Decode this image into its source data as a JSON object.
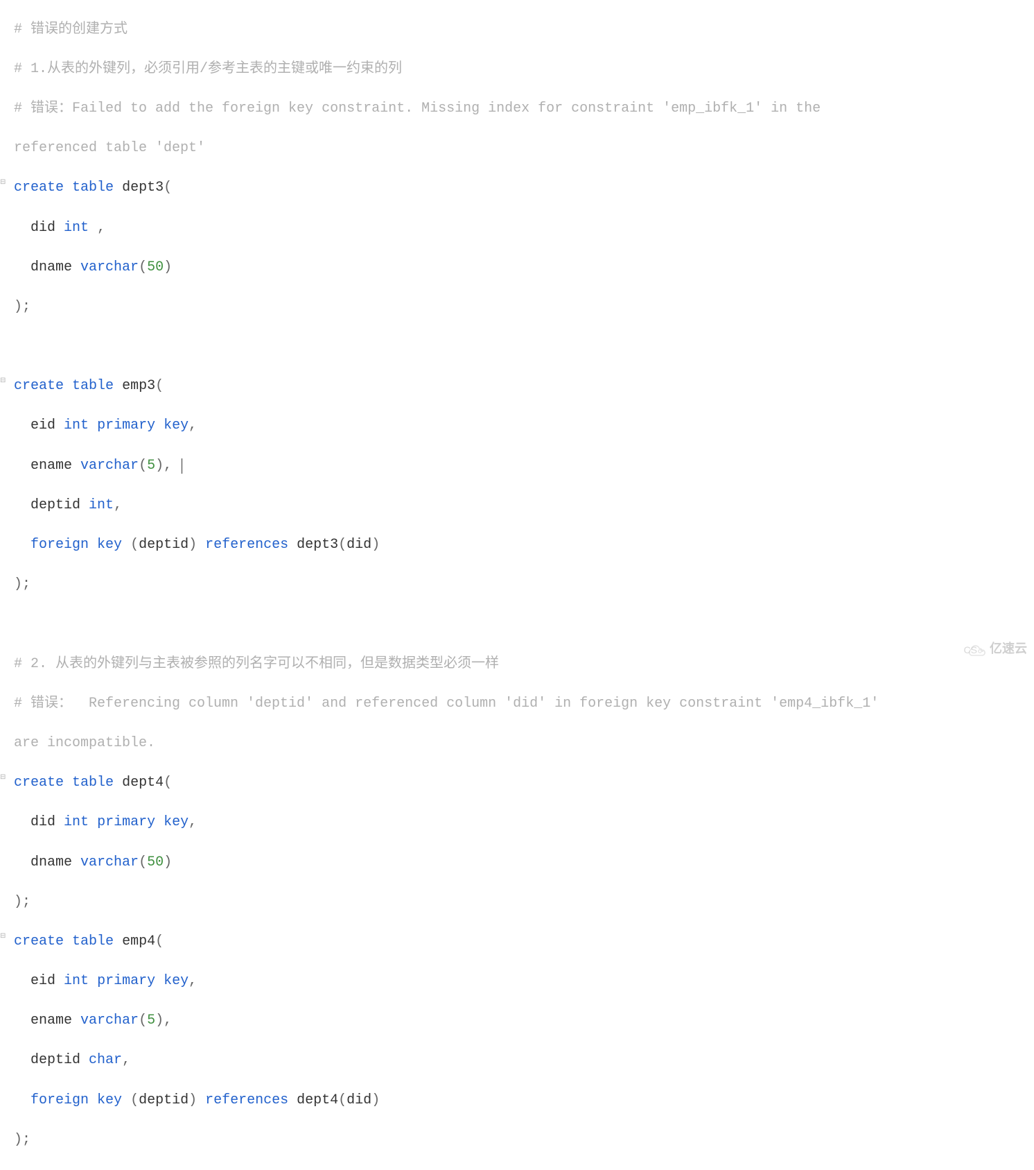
{
  "lines": {
    "l1": {
      "comment": " # 错误的创建方式"
    },
    "l2": {
      "comment": " # 1.从表的外键列，必须引用/参考主表的主键或唯一约束的列"
    },
    "l3": {
      "comment": " # 错误：Failed to add the foreign key constraint. Missing index for constraint 'emp_ibfk_1' in the "
    },
    "l4": {
      "comment": " referenced table 'dept'"
    },
    "l5": {
      "kw1": "create",
      "kw2": "table",
      "name": "dept3",
      "open": "("
    },
    "l6": {
      "indent": "   ",
      "col": "did",
      "type": "int",
      "tail": " ,"
    },
    "l7": {
      "indent": "   ",
      "col": "dname",
      "type": "varchar",
      "open": "(",
      "n": "50",
      "close": ")"
    },
    "l8": {
      "close": " );"
    },
    "l9": {
      "blank": " "
    },
    "l10": {
      "kw1": "create",
      "kw2": "table",
      "name": "emp3",
      "open": "("
    },
    "l11": {
      "indent": "   ",
      "col": "eid",
      "type": "int",
      "kw3": "primary",
      "kw4": "key",
      "tail": ","
    },
    "l12": {
      "indent": "   ",
      "col": "ename",
      "type": "varchar",
      "open": "(",
      "n": "5",
      "close": "),",
      "cursor": true
    },
    "l13": {
      "indent": "   ",
      "col": "deptid",
      "type": "int",
      "tail": ","
    },
    "l14": {
      "indent": "   ",
      "kw1": "foreign",
      "kw2": "key",
      "open1": " (",
      "arg1": "deptid",
      "close1": ") ",
      "kw3": "references",
      "tbl": " dept3",
      "open2": "(",
      "arg2": "did",
      "close2": ")"
    },
    "l15": {
      "close": " );"
    },
    "l16": {
      "blank": " "
    },
    "l17": {
      "comment": " # 2. 从表的外键列与主表被参照的列名字可以不相同，但是数据类型必须一样"
    },
    "l18": {
      "comment": " # 错误：  Referencing column 'deptid' and referenced column 'did' in foreign key constraint 'emp4_ibfk_1' "
    },
    "l19": {
      "comment": " are incompatible."
    },
    "l20": {
      "kw1": "create",
      "kw2": "table",
      "name": "dept4",
      "open": "("
    },
    "l21": {
      "indent": "   ",
      "col": "did",
      "type": "int",
      "kw3": "primary",
      "kw4": "key",
      "tail": ","
    },
    "l22": {
      "indent": "   ",
      "col": "dname",
      "type": "varchar",
      "open": "(",
      "n": "50",
      "close": ")"
    },
    "l23": {
      "close": " );"
    },
    "l24": {
      "kw1": "create",
      "kw2": "table",
      "name": "emp4",
      "open": "("
    },
    "l25": {
      "indent": "   ",
      "col": "eid",
      "type": "int",
      "kw3": "primary",
      "kw4": "key",
      "tail": ","
    },
    "l26": {
      "indent": "   ",
      "col": "ename",
      "type": "varchar",
      "open": "(",
      "n": "5",
      "close": "),"
    },
    "l27": {
      "indent": "   ",
      "col": "deptid",
      "type": "char",
      "tail": ","
    },
    "l28": {
      "indent": "   ",
      "kw1": "foreign",
      "kw2": "key",
      "open1": " (",
      "arg1": "deptid",
      "close1": ") ",
      "kw3": "references",
      "tbl": " dept4",
      "open2": "(",
      "arg2": "did",
      "close2": ")"
    },
    "l29": {
      "close": " );"
    }
  },
  "watermark": {
    "text": "亿速云",
    "cs": "CS"
  }
}
